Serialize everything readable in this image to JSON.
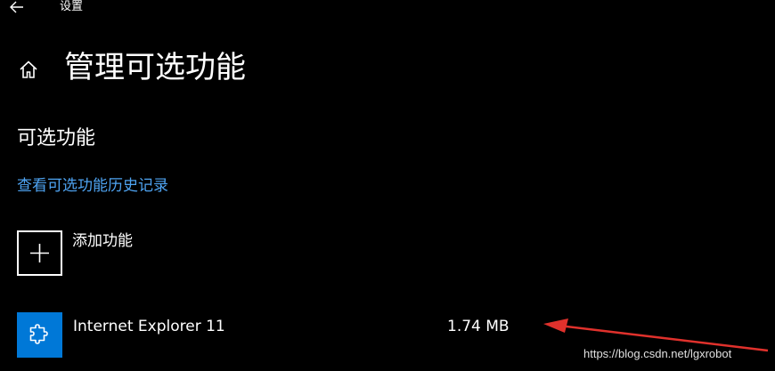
{
  "window": {
    "app_title": "设置",
    "back_icon": "arrow-left-icon"
  },
  "header": {
    "home_icon": "home-icon",
    "title": "管理可选功能"
  },
  "section": {
    "title": "可选功能",
    "history_link": "查看可选功能历史记录"
  },
  "add_feature": {
    "icon": "plus-icon",
    "label": "添加功能"
  },
  "features": [
    {
      "icon": "puzzle-piece-icon",
      "name": "Internet Explorer 11",
      "size": "1.74 MB"
    }
  ],
  "annotation": {
    "arrow_color": "#e0312c"
  },
  "watermark": {
    "text": "https://blog.csdn.net/lgxrobot"
  },
  "colors": {
    "background": "#000000",
    "accent": "#0078d7",
    "link": "#4ea3f1"
  }
}
